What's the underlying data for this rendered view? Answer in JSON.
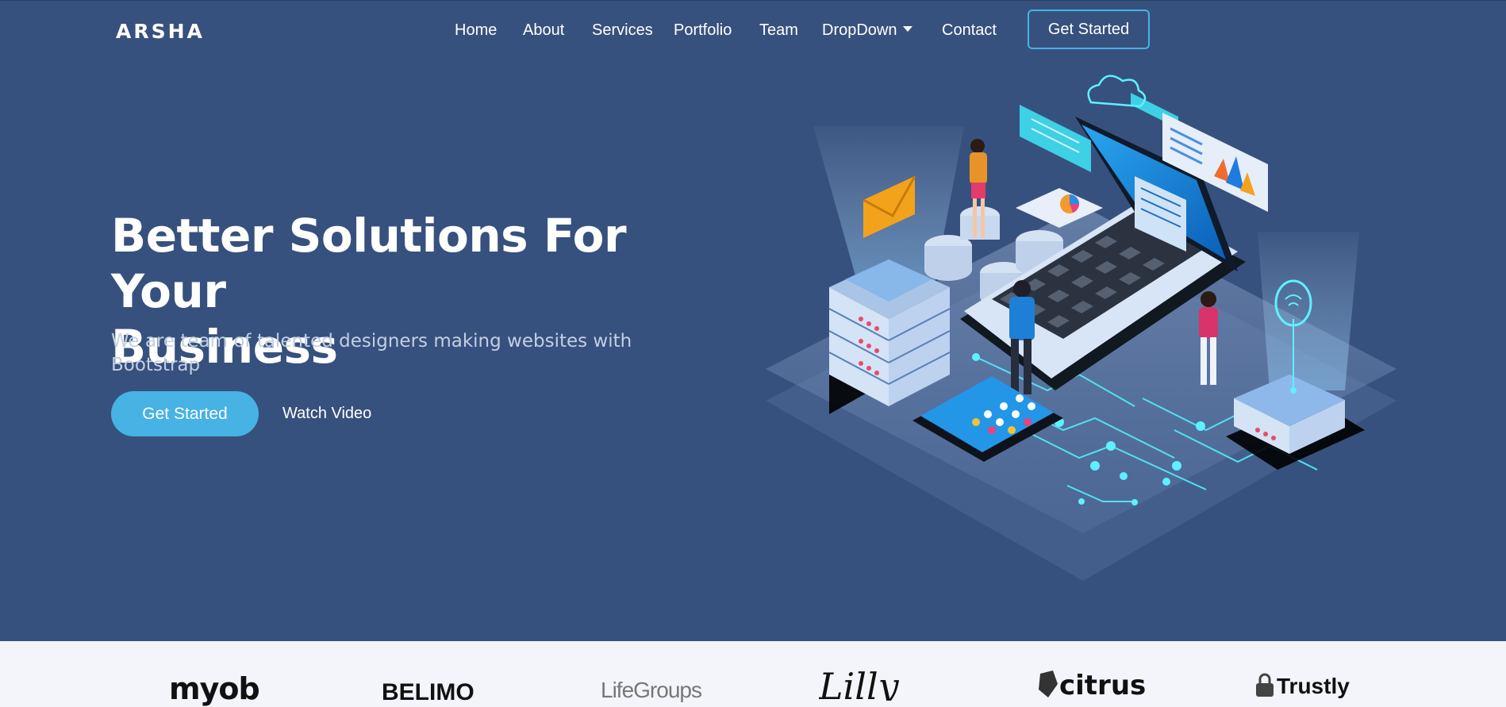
{
  "brand": {
    "name": "ARSHA"
  },
  "nav": {
    "items": [
      {
        "label": "Home"
      },
      {
        "label": "About"
      },
      {
        "label": "Services"
      },
      {
        "label": "Portfolio"
      },
      {
        "label": "Team"
      },
      {
        "label": "DropDown",
        "has_caret": true
      },
      {
        "label": "Contact"
      }
    ],
    "cta_label": "Get Started"
  },
  "hero": {
    "title_line1": "Better Solutions For Your",
    "title_line2": "Business",
    "subtitle": "We are team of talented designers making websites with Bootstrap",
    "primary_button": "Get Started",
    "video_link": "Watch Video"
  },
  "clients": [
    {
      "name": "myob"
    },
    {
      "name": "BELIMO"
    },
    {
      "name": "LifeGroups"
    },
    {
      "name": "Lilly"
    },
    {
      "name": "citrus"
    },
    {
      "name": "Trustly"
    }
  ],
  "colors": {
    "hero_bg": "#37517e",
    "accent": "#47b2e4",
    "clients_bg": "#f3f5fa"
  }
}
